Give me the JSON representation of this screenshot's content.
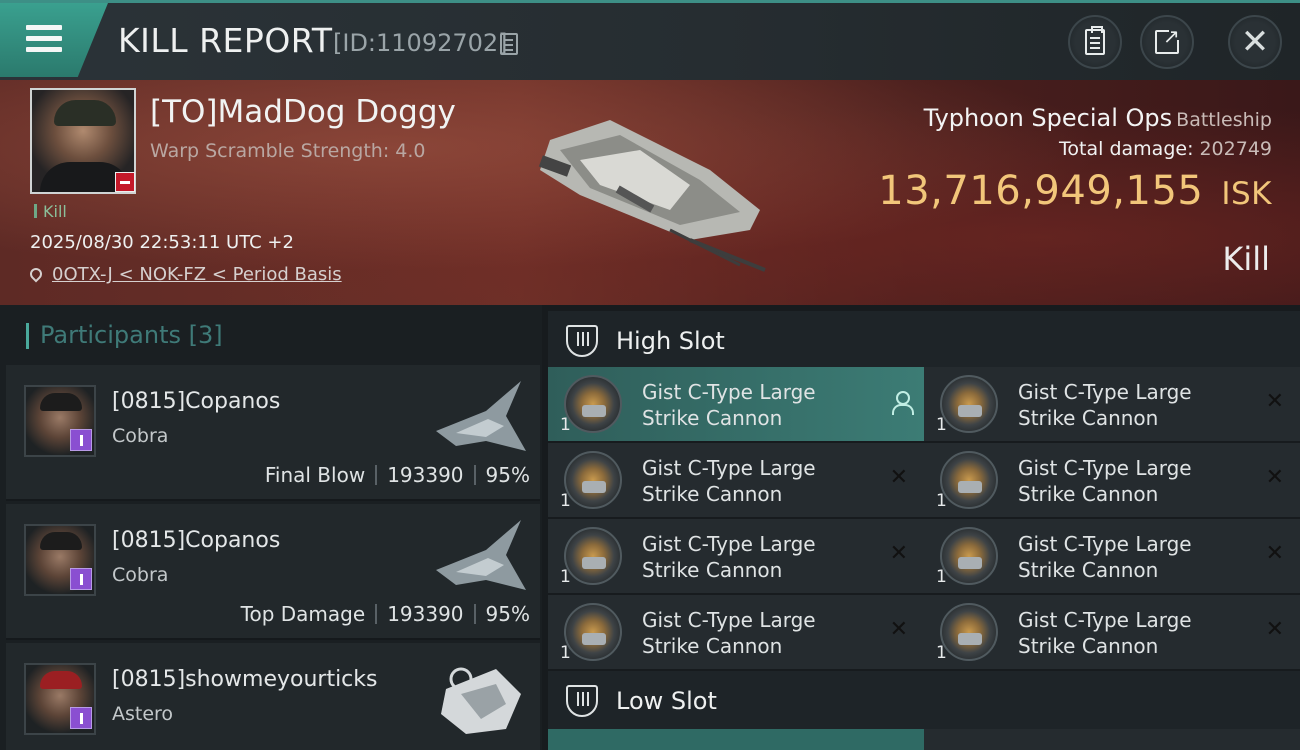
{
  "header": {
    "title": "KILL REPORT",
    "report_id": "[ID:11092702]"
  },
  "victim": {
    "name": "[TO]MadDog Doggy",
    "warp_scramble": "Warp Scramble Strength: 4.0",
    "tag": "Kill",
    "datetime": "2025/08/30 22:53:11 UTC +2",
    "location": "0OTX-J < NOK-FZ < Period Basis"
  },
  "ship": {
    "name": "Typhoon Special Ops",
    "class": "Battleship",
    "total_damage_label": "Total damage:",
    "total_damage": "202749",
    "isk_value": "13,716,949,155",
    "isk_unit": "ISK",
    "result": "Kill"
  },
  "participants": {
    "label": "Participants",
    "count": "[3]",
    "items": [
      {
        "name": "[0815]Copanos",
        "ship": "Cobra",
        "role": "Final Blow",
        "damage": "193390",
        "percent": "95%"
      },
      {
        "name": "[0815]Copanos",
        "ship": "Cobra",
        "role": "Top Damage",
        "damage": "193390",
        "percent": "95%"
      },
      {
        "name": "[0815]showmeyourticks",
        "ship": "Astero",
        "role": "",
        "damage": "",
        "percent": ""
      }
    ]
  },
  "fittings": {
    "high_slot_title": "High Slot",
    "low_slot_title": "Low Slot",
    "high_slot_modules": [
      {
        "line1": "Gist C-Type Large",
        "line2": "Strike Cannon",
        "qty": "1",
        "status": "person"
      },
      {
        "line1": "Gist C-Type Large",
        "line2": "Strike Cannon",
        "qty": "1",
        "status": "✕"
      },
      {
        "line1": "Gist C-Type Large",
        "line2": "Strike Cannon",
        "qty": "1",
        "status": "✕"
      },
      {
        "line1": "Gist C-Type Large",
        "line2": "Strike Cannon",
        "qty": "1",
        "status": "✕"
      },
      {
        "line1": "Gist C-Type Large",
        "line2": "Strike Cannon",
        "qty": "1",
        "status": "✕"
      },
      {
        "line1": "Gist C-Type Large",
        "line2": "Strike Cannon",
        "qty": "1",
        "status": "✕"
      },
      {
        "line1": "Gist C-Type Large",
        "line2": "Strike Cannon",
        "qty": "1",
        "status": "✕"
      },
      {
        "line1": "Gist C-Type Large",
        "line2": "Strike Cannon",
        "qty": "1",
        "status": "✕"
      }
    ]
  }
}
